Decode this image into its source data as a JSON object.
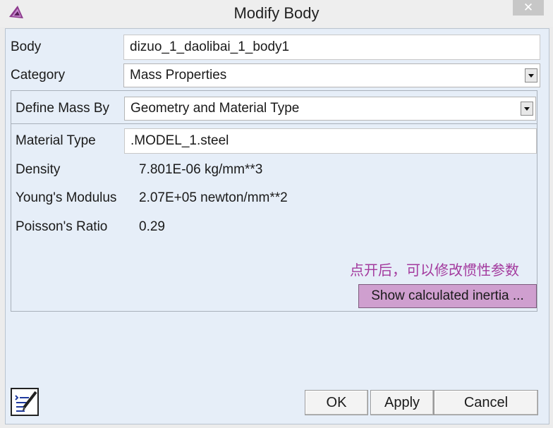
{
  "window": {
    "title": "Modify Body",
    "close_glyph": "✕",
    "app_icon": "app-logo-icon"
  },
  "form": {
    "body_label": "Body",
    "body_value": "dizuo_1_daolibai_1_body1",
    "category_label": "Category",
    "category_value": "Mass Properties"
  },
  "mass_group": {
    "define_label": "Define Mass By",
    "define_value": "Geometry and Material Type",
    "material_label": "Material Type",
    "material_value": ".MODEL_1.steel",
    "properties": [
      {
        "label": "Density",
        "value": "7.801E-06 kg/mm**3"
      },
      {
        "label": "Young's Modulus",
        "value": "2.07E+05 newton/mm**2"
      },
      {
        "label": "Poisson's Ratio",
        "value": "0.29"
      }
    ],
    "note": "点开后，可以修改惯性参数",
    "show_inertia_label": "Show calculated inertia ..."
  },
  "footer": {
    "ok_label": "OK",
    "apply_label": "Apply",
    "cancel_label": "Cancel",
    "note_icon": "edit-notes-icon"
  },
  "colors": {
    "dialog_bg": "#e6eef8",
    "highlight_button": "#cf9fcf",
    "note_text": "#a33a9e",
    "app_icon": "#8c3a8c"
  }
}
